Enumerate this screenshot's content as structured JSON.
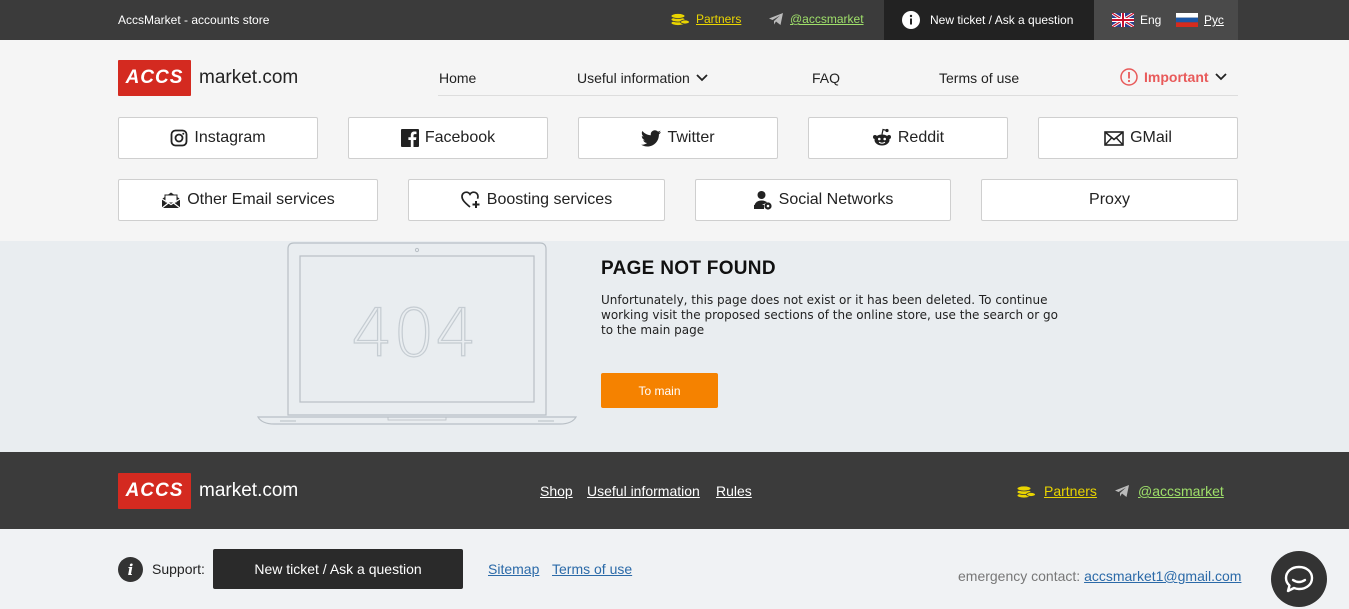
{
  "topbar": {
    "brand": "AccsMarket - accounts store",
    "partners": "Partners",
    "telegram": "@accsmarket",
    "ticket": "New ticket / Ask a question",
    "lang_eng": "Eng",
    "lang_rus": "Рус"
  },
  "header": {
    "logo_box": "ACCS",
    "logo_domain": "market.com",
    "nav": {
      "home": "Home",
      "useful": "Useful information",
      "faq": "FAQ",
      "terms": "Terms of use",
      "important": "Important"
    }
  },
  "categories": {
    "instagram": "Instagram",
    "facebook": "Facebook",
    "twitter": "Twitter",
    "reddit": "Reddit",
    "gmail": "GMail",
    "other_email": "Other Email services",
    "boosting": "Boosting services",
    "social": "Social Networks",
    "proxy": "Proxy"
  },
  "notfound": {
    "code": "404",
    "title": "PAGE NOT FOUND",
    "text": "Unfortunately, this page does not exist or it has been deleted. To continue working visit the proposed sections of the online store, use the search or go to the main page",
    "button": "To main"
  },
  "footer": {
    "logo_box": "ACCS",
    "logo_domain": "market.com",
    "shop": "Shop",
    "useful": "Useful information",
    "rules": "Rules",
    "partners": "Partners",
    "telegram": "@accsmarket"
  },
  "bottom": {
    "support_label": "Support:",
    "support_button": "New ticket / Ask a question",
    "sitemap": "Sitemap",
    "terms": "Terms of use",
    "emergency_label": "emergency contact:",
    "emergency_email": "accsmarket1@gmail.com"
  },
  "colors": {
    "accent_red": "#d42a20",
    "orange": "#f58200",
    "dark": "#3b3b3b",
    "partners_yellow": "#e9d400",
    "telegram_green": "#9fe06a",
    "important_red": "#e85a5a",
    "link_blue": "#2b6aa8"
  },
  "icons": [
    "coins-icon",
    "telegram-icon",
    "info-icon",
    "uk-flag-icon",
    "ru-flag-icon",
    "chevron-down-icon",
    "warning-icon",
    "instagram-icon",
    "facebook-icon",
    "twitter-icon",
    "reddit-icon",
    "mail-icon",
    "email-open-icon",
    "heart-plus-icon",
    "user-icon",
    "chat-icon"
  ]
}
